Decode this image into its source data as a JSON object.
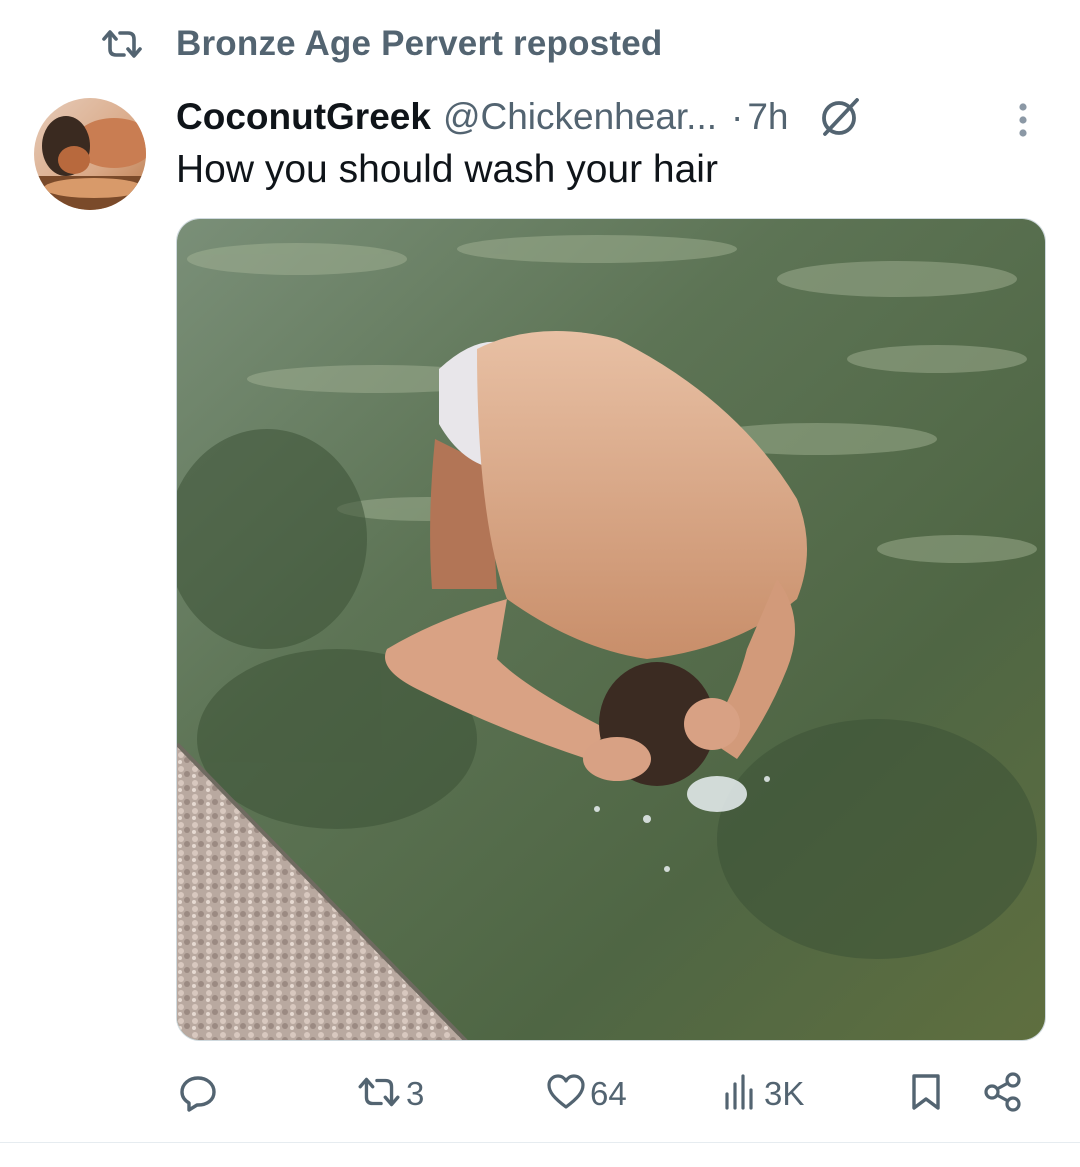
{
  "repost": {
    "icon": "repost-icon",
    "label": "Bronze Age Pervert reposted"
  },
  "tweet": {
    "author": {
      "display_name": "CoconutGreek",
      "handle": "@Chickenhear...",
      "avatar": "avatar-photo"
    },
    "separator": "·",
    "time": "7h",
    "text": "How you should wash your hair",
    "media": "photo-man-washing-hair-in-sea"
  },
  "actions": {
    "reply": {
      "icon": "reply-icon",
      "count": ""
    },
    "repost": {
      "icon": "repost-icon",
      "count": "3"
    },
    "like": {
      "icon": "heart-icon",
      "count": "64"
    },
    "views": {
      "icon": "views-icon",
      "count": "3K"
    },
    "bookmark": {
      "icon": "bookmark-icon"
    },
    "share": {
      "icon": "share-icon"
    }
  },
  "colors": {
    "primary_text": "#0f1419",
    "secondary_text": "#536471",
    "border": "#cfd9de"
  }
}
